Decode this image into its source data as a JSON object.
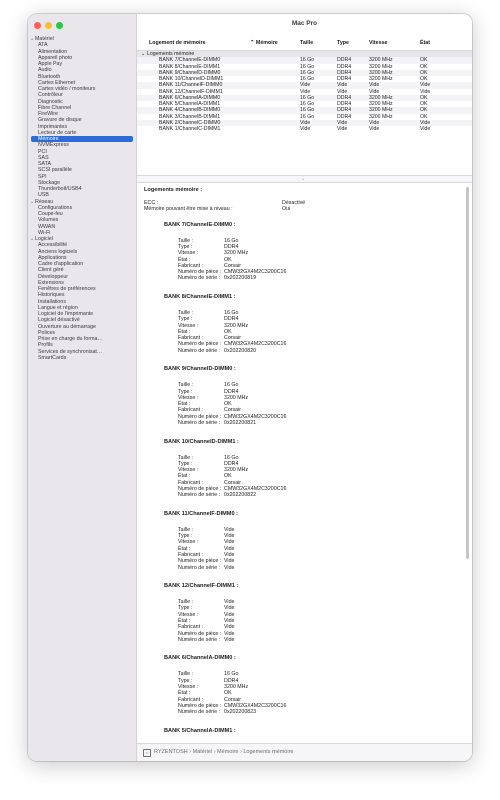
{
  "window": {
    "title": "Mac Pro"
  },
  "sidebar": {
    "groups": [
      {
        "label": "Matériel",
        "items": [
          "ATA",
          "Alimentation",
          "Appareil photo",
          "Apple Pay",
          "Audio",
          "Bluetooth",
          "Cartes Ethernet",
          "Cartes vidéo / moniteurs",
          "Contrôleur",
          "Diagnostic",
          "Fibre Channel",
          "FireWire",
          "Gravure de disque",
          "Imprimantes",
          "Lecteur de carte",
          "Mémoire",
          "NVMExpress",
          "PCI",
          "SAS",
          "SATA",
          "SCSI parallèle",
          "SPI",
          "Stockage",
          "Thunderbolt/USB4",
          "USB"
        ]
      },
      {
        "label": "Réseau",
        "items": [
          "Configurations",
          "Coupe-feu",
          "Volumes",
          "WWAN",
          "Wi-Fi"
        ]
      },
      {
        "label": "Logiciel",
        "items": [
          "Accessibilité",
          "Anciens logiciels",
          "Applications",
          "Cadre d'application",
          "Client géré",
          "Développeur",
          "Extensions",
          "Fenêtres de préférences",
          "Historiques",
          "Installations",
          "Langue et région",
          "Logiciel de l'imprimante",
          "Logiciel désactivé",
          "Ouverture au démarrage",
          "Polices",
          "Prise en charge du forma…",
          "Profils",
          "Services de synchronisat…",
          "SmartCards"
        ]
      }
    ],
    "selected": "Mémoire"
  },
  "table": {
    "columns": [
      "Logement de mémoire",
      "Mémoire",
      "Taille",
      "Type",
      "Vitesse",
      "État"
    ],
    "group_label": "Logements mémoire",
    "rows": [
      [
        "BANK 7/ChannelE-DIMM0",
        "",
        "16 Go",
        "DDR4",
        "3200 MHz",
        "OK"
      ],
      [
        "BANK 8/ChannelE-DIMM1",
        "",
        "16 Go",
        "DDR4",
        "3200 MHz",
        "OK"
      ],
      [
        "BANK 9/ChannelD-DIMM0",
        "",
        "16 Go",
        "DDR4",
        "3200 MHz",
        "OK"
      ],
      [
        "BANK 10/ChannelD-DIMM1",
        "",
        "16 Go",
        "DDR4",
        "3200 MHz",
        "OK"
      ],
      [
        "BANK 11/ChannelF-DIMM0",
        "",
        "Vide",
        "Vide",
        "Vide",
        "Vide"
      ],
      [
        "BANK 12/ChannelF-DIMM1",
        "",
        "Vide",
        "Vide",
        "Vide",
        "Vide"
      ],
      [
        "BANK 6/ChannelA-DIMM0",
        "",
        "16 Go",
        "DDR4",
        "3200 MHz",
        "OK"
      ],
      [
        "BANK 5/ChannelA-DIMM1",
        "",
        "16 Go",
        "DDR4",
        "3200 MHz",
        "OK"
      ],
      [
        "BANK 4/ChannelB-DIMM0",
        "",
        "16 Go",
        "DDR4",
        "3200 MHz",
        "OK"
      ],
      [
        "BANK 3/ChannelB-DIMM1",
        "",
        "16 Go",
        "DDR4",
        "3200 MHz",
        "OK"
      ],
      [
        "BANK 2/ChannelC-DIMM0",
        "",
        "Vide",
        "Vide",
        "Vide",
        "Vide"
      ],
      [
        "BANK 1/ChannelC-DIMM1",
        "",
        "Vide",
        "Vide",
        "Vide",
        "Vide"
      ]
    ]
  },
  "detail": {
    "heading": "Logements mémoire :",
    "summary": [
      {
        "label": "ECC :",
        "value": "Désactivé"
      },
      {
        "label": "Mémoire pouvant être mise à niveau :",
        "value": "Oui"
      }
    ],
    "field_labels": [
      "Taille :",
      "Type :",
      "Vitesse :",
      "État :",
      "Fabricant :",
      "Numéro de pièce :",
      "Numéro de série :"
    ],
    "banks": [
      {
        "title": "BANK 7/ChannelE-DIMM0 :",
        "values": [
          "16 Go",
          "DDR4",
          "3200 MHz",
          "OK",
          "Corsair",
          "CMW32GX4M2C3200C16",
          "0x202200819"
        ]
      },
      {
        "title": "BANK 8/ChannelE-DIMM1 :",
        "values": [
          "16 Go",
          "DDR4",
          "3200 MHz",
          "OK",
          "Corsair",
          "CMW32GX4M2C3200C16",
          "0x202200820"
        ]
      },
      {
        "title": "BANK 9/ChannelD-DIMM0 :",
        "values": [
          "16 Go",
          "DDR4",
          "3200 MHz",
          "OK",
          "Corsair",
          "CMW32GX4M2C3200C16",
          "0x202200821"
        ]
      },
      {
        "title": "BANK 10/ChannelD-DIMM1 :",
        "values": [
          "16 Go",
          "DDR4",
          "3200 MHz",
          "OK",
          "Corsair",
          "CMW32GX4M2C3200C16",
          "0x202200822"
        ]
      },
      {
        "title": "BANK 11/ChannelF-DIMM0 :",
        "values": [
          "Vide",
          "Vide",
          "Vide",
          "Vide",
          "Vide",
          "Vide",
          "Vide"
        ]
      },
      {
        "title": "BANK 12/ChannelF-DIMM1 :",
        "values": [
          "Vide",
          "Vide",
          "Vide",
          "Vide",
          "Vide",
          "Vide",
          "Vide"
        ]
      },
      {
        "title": "BANK 6/ChannelA-DIMM0 :",
        "values": [
          "16 Go",
          "DDR4",
          "3200 MHz",
          "OK",
          "Corsair",
          "CMW32GX4M2C3200C16",
          "0x202200823"
        ]
      },
      {
        "title": "BANK 5/ChannelA-DIMM1 :",
        "values": [
          "16 Go",
          "DDR4",
          "3200 MHz",
          "OK",
          "Corsair",
          "CMW32GX4M2C3200C16",
          ""
        ]
      }
    ]
  },
  "statusbar": {
    "path": "RYZENTOSH › Matériel › Mémoire › Logements mémoire"
  },
  "colors": {
    "close": "#ff5f57",
    "minimize": "#febc2e",
    "zoom": "#28c840",
    "selection": "#2d6bd6"
  }
}
